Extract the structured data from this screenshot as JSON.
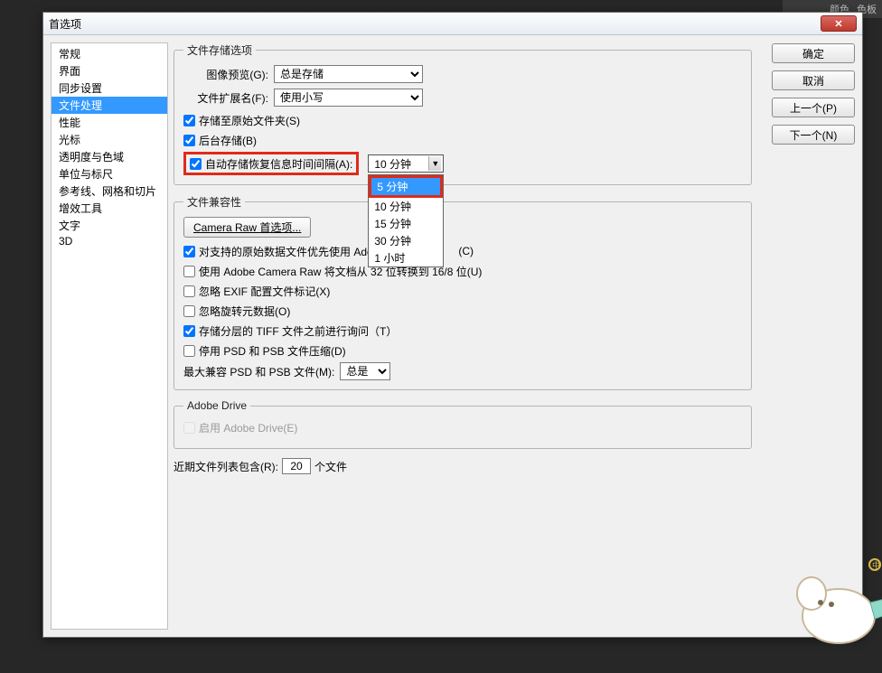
{
  "bg": {
    "tab1": "颜色",
    "tab2": "色板"
  },
  "dialog": {
    "title": "首选项",
    "buttons": {
      "ok": "确定",
      "cancel": "取消",
      "prev": "上一个(P)",
      "next": "下一个(N)"
    }
  },
  "sidebar": {
    "items": [
      "常规",
      "界面",
      "同步设置",
      "文件处理",
      "性能",
      "光标",
      "透明度与色域",
      "单位与标尺",
      "参考线、网格和切片",
      "增效工具",
      "文字",
      "3D"
    ],
    "active": 3
  },
  "storage": {
    "legend": "文件存储选项",
    "preview_label": "图像预览(G):",
    "preview_value": "总是存储",
    "ext_label": "文件扩展名(F):",
    "ext_value": "使用小写",
    "save_orig_folder": "存储至原始文件夹(S)",
    "bg_save": "后台存储(B)",
    "autosave": {
      "label": "自动存储恢复信息时间间隔(A):",
      "value": "10 分钟",
      "options": [
        "5 分钟",
        "10 分钟",
        "15 分钟",
        "30 分钟",
        "1 小时"
      ],
      "highlight_index": 0
    }
  },
  "compat": {
    "legend": "文件兼容性",
    "camera_raw_btn": "Camera Raw 首选项...",
    "prefer_raw": "对支持的原始数据文件优先使用 Adob",
    "prefer_raw_suffix": "(C)",
    "acr_32to16": "使用 Adobe Camera Raw 将文档从 32 位转换到 16/8 位(U)",
    "ignore_exif": "忽略 EXIF 配置文件标记(X)",
    "ignore_rotate": "忽略旋转元数据(O)",
    "tiff_ask": "存储分层的 TIFF 文件之前进行询问（T）",
    "disable_psb": "停用 PSD 和 PSB 文件压缩(D)",
    "max_compat_label": "最大兼容 PSD 和 PSB 文件(M):",
    "max_compat_value": "总是"
  },
  "drive": {
    "legend": "Adobe Drive",
    "enable": "启用 Adobe Drive(E)"
  },
  "recent": {
    "label_pre": "近期文件列表包含(R):",
    "count": "20",
    "label_post": "个文件"
  }
}
